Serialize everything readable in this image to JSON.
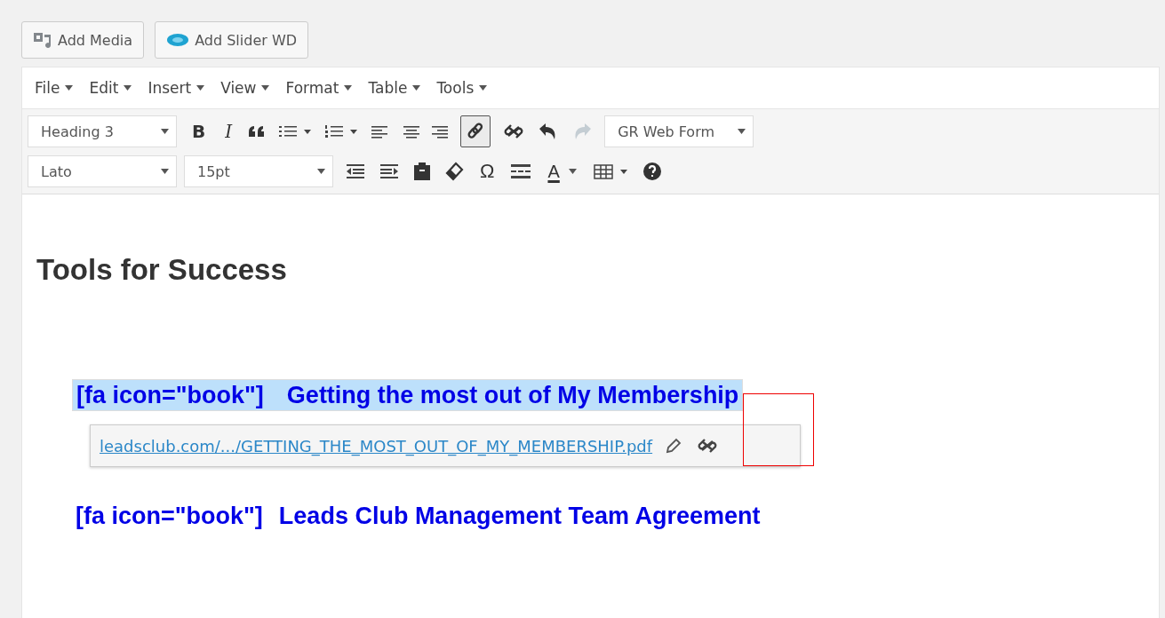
{
  "media_buttons": [
    {
      "label": "Add Media",
      "kind": "media"
    },
    {
      "label": "Add Slider WD",
      "kind": "slider"
    }
  ],
  "menubar": [
    "File",
    "Edit",
    "Insert",
    "View",
    "Format",
    "Table",
    "Tools"
  ],
  "toolbar": {
    "block_format": "Heading 3",
    "bold": "B",
    "italic": "I",
    "link_selected": true,
    "redo_disabled": true,
    "form_select": "GR Web Form",
    "font_family": "Lato",
    "font_size": "15pt",
    "special_char": "Ω",
    "text_color": "A"
  },
  "content": {
    "heading": "Tools for Success",
    "links": [
      {
        "shortcode": "[fa icon=\"book\"]",
        "title": "Getting the most out of My Membership",
        "selected": true
      },
      {
        "shortcode": "[fa icon=\"book\"]",
        "title": "Leads Club Management Team Agreement",
        "selected": false
      }
    ],
    "link_popup": {
      "url": "leadsclub.com/.../GETTING_THE_MOST_OUT_OF_MY_MEMBERSHIP.pdf"
    }
  }
}
